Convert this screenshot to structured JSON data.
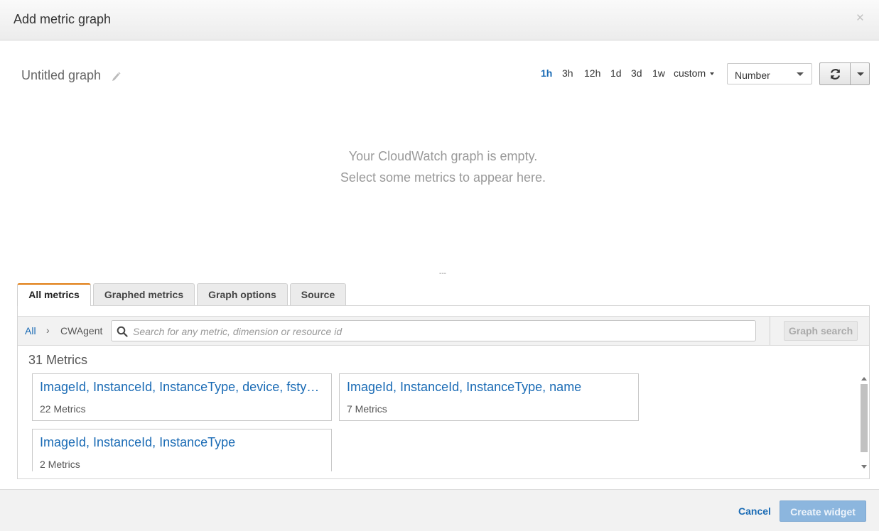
{
  "header": {
    "title": "Add metric graph",
    "close_glyph": "×"
  },
  "graph": {
    "title": "Untitled graph"
  },
  "time_ranges": {
    "items": [
      "1h",
      "3h",
      "12h",
      "1d",
      "3d",
      "1w"
    ],
    "active": "1h",
    "custom_label": "custom"
  },
  "view_select": {
    "value": "Number"
  },
  "empty_state": {
    "line1": "Your CloudWatch graph is empty.",
    "line2": "Select some metrics to appear here."
  },
  "resize_handle": "---",
  "tabs": [
    "All metrics",
    "Graphed metrics",
    "Graph options",
    "Source"
  ],
  "active_tab": "All metrics",
  "breadcrumb": {
    "all": "All",
    "separator": "›",
    "namespace": "CWAgent"
  },
  "search": {
    "placeholder": "Search for any metric, dimension or resource id",
    "value": ""
  },
  "graph_search_label": "Graph search",
  "metrics_count": "31 Metrics",
  "cards": [
    {
      "title": "ImageId, InstanceId, InstanceType, device, fstype, path",
      "count": "22 Metrics"
    },
    {
      "title": "ImageId, InstanceId, InstanceType, name",
      "count": "7 Metrics"
    },
    {
      "title": "ImageId, InstanceId, InstanceType",
      "count": "2 Metrics"
    }
  ],
  "footer": {
    "cancel_label": "Cancel",
    "create_label": "Create widget"
  },
  "colors": {
    "link": "#1a6bb5",
    "active_tab_accent": "#e07b10",
    "primary_disabled": "#8cb6de"
  },
  "icons": [
    "close-icon",
    "pencil-icon",
    "caret-down-icon",
    "refresh-icon",
    "search-icon",
    "chevron-right-icon"
  ]
}
